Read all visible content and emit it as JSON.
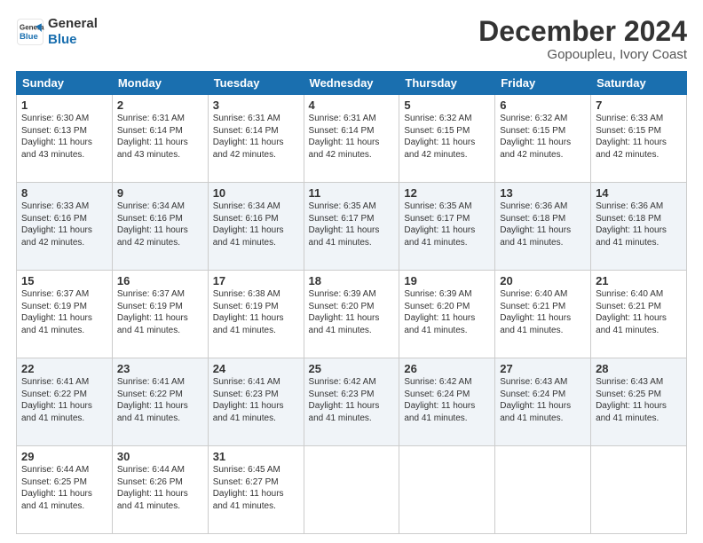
{
  "header": {
    "logo_line1": "General",
    "logo_line2": "Blue",
    "month": "December 2024",
    "location": "Gopoupleu, Ivory Coast"
  },
  "days": [
    "Sunday",
    "Monday",
    "Tuesday",
    "Wednesday",
    "Thursday",
    "Friday",
    "Saturday"
  ],
  "weeks": [
    [
      {
        "day": "1",
        "rise": "6:30 AM",
        "set": "6:13 PM",
        "daylight": "11 hours and 43 minutes."
      },
      {
        "day": "2",
        "rise": "6:31 AM",
        "set": "6:14 PM",
        "daylight": "11 hours and 43 minutes."
      },
      {
        "day": "3",
        "rise": "6:31 AM",
        "set": "6:14 PM",
        "daylight": "11 hours and 42 minutes."
      },
      {
        "day": "4",
        "rise": "6:31 AM",
        "set": "6:14 PM",
        "daylight": "11 hours and 42 minutes."
      },
      {
        "day": "5",
        "rise": "6:32 AM",
        "set": "6:15 PM",
        "daylight": "11 hours and 42 minutes."
      },
      {
        "day": "6",
        "rise": "6:32 AM",
        "set": "6:15 PM",
        "daylight": "11 hours and 42 minutes."
      },
      {
        "day": "7",
        "rise": "6:33 AM",
        "set": "6:15 PM",
        "daylight": "11 hours and 42 minutes."
      }
    ],
    [
      {
        "day": "8",
        "rise": "6:33 AM",
        "set": "6:16 PM",
        "daylight": "11 hours and 42 minutes."
      },
      {
        "day": "9",
        "rise": "6:34 AM",
        "set": "6:16 PM",
        "daylight": "11 hours and 42 minutes."
      },
      {
        "day": "10",
        "rise": "6:34 AM",
        "set": "6:16 PM",
        "daylight": "11 hours and 41 minutes."
      },
      {
        "day": "11",
        "rise": "6:35 AM",
        "set": "6:17 PM",
        "daylight": "11 hours and 41 minutes."
      },
      {
        "day": "12",
        "rise": "6:35 AM",
        "set": "6:17 PM",
        "daylight": "11 hours and 41 minutes."
      },
      {
        "day": "13",
        "rise": "6:36 AM",
        "set": "6:18 PM",
        "daylight": "11 hours and 41 minutes."
      },
      {
        "day": "14",
        "rise": "6:36 AM",
        "set": "6:18 PM",
        "daylight": "11 hours and 41 minutes."
      }
    ],
    [
      {
        "day": "15",
        "rise": "6:37 AM",
        "set": "6:19 PM",
        "daylight": "11 hours and 41 minutes."
      },
      {
        "day": "16",
        "rise": "6:37 AM",
        "set": "6:19 PM",
        "daylight": "11 hours and 41 minutes."
      },
      {
        "day": "17",
        "rise": "6:38 AM",
        "set": "6:19 PM",
        "daylight": "11 hours and 41 minutes."
      },
      {
        "day": "18",
        "rise": "6:39 AM",
        "set": "6:20 PM",
        "daylight": "11 hours and 41 minutes."
      },
      {
        "day": "19",
        "rise": "6:39 AM",
        "set": "6:20 PM",
        "daylight": "11 hours and 41 minutes."
      },
      {
        "day": "20",
        "rise": "6:40 AM",
        "set": "6:21 PM",
        "daylight": "11 hours and 41 minutes."
      },
      {
        "day": "21",
        "rise": "6:40 AM",
        "set": "6:21 PM",
        "daylight": "11 hours and 41 minutes."
      }
    ],
    [
      {
        "day": "22",
        "rise": "6:41 AM",
        "set": "6:22 PM",
        "daylight": "11 hours and 41 minutes."
      },
      {
        "day": "23",
        "rise": "6:41 AM",
        "set": "6:22 PM",
        "daylight": "11 hours and 41 minutes."
      },
      {
        "day": "24",
        "rise": "6:41 AM",
        "set": "6:23 PM",
        "daylight": "11 hours and 41 minutes."
      },
      {
        "day": "25",
        "rise": "6:42 AM",
        "set": "6:23 PM",
        "daylight": "11 hours and 41 minutes."
      },
      {
        "day": "26",
        "rise": "6:42 AM",
        "set": "6:24 PM",
        "daylight": "11 hours and 41 minutes."
      },
      {
        "day": "27",
        "rise": "6:43 AM",
        "set": "6:24 PM",
        "daylight": "11 hours and 41 minutes."
      },
      {
        "day": "28",
        "rise": "6:43 AM",
        "set": "6:25 PM",
        "daylight": "11 hours and 41 minutes."
      }
    ],
    [
      {
        "day": "29",
        "rise": "6:44 AM",
        "set": "6:25 PM",
        "daylight": "11 hours and 41 minutes."
      },
      {
        "day": "30",
        "rise": "6:44 AM",
        "set": "6:26 PM",
        "daylight": "11 hours and 41 minutes."
      },
      {
        "day": "31",
        "rise": "6:45 AM",
        "set": "6:27 PM",
        "daylight": "11 hours and 41 minutes."
      },
      null,
      null,
      null,
      null
    ]
  ]
}
